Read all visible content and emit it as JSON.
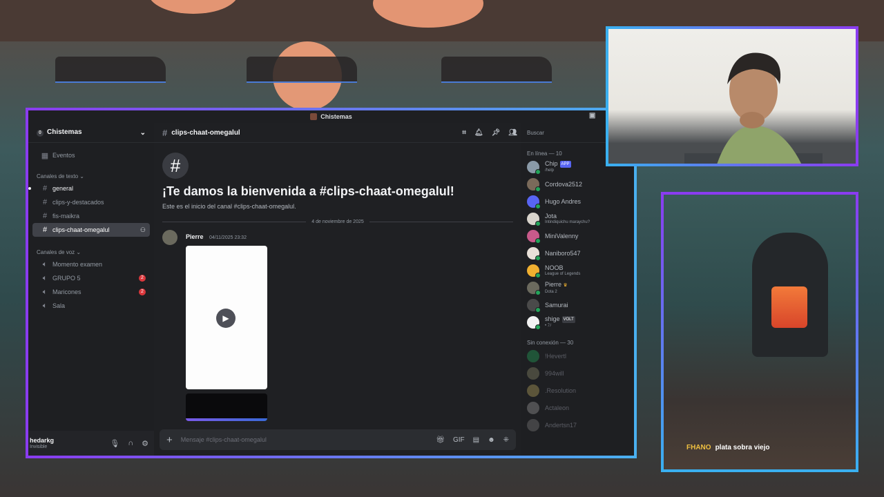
{
  "window": {
    "title": "Chistemas"
  },
  "server": {
    "name": "Chistemas",
    "icon_letter": "0",
    "events_label": "Eventos"
  },
  "sidebar": {
    "text_category": "Canales de texto",
    "text_channels": [
      {
        "name": "general",
        "unread": true
      },
      {
        "name": "clips-y-destacados"
      },
      {
        "name": "fis-maikra"
      },
      {
        "name": "clips-chaat-omegalul",
        "active": true
      }
    ],
    "voice_category": "Canales de voz",
    "voice_channels": [
      {
        "name": "Momento examen"
      },
      {
        "name": "GRUPO 5",
        "badge": "2"
      },
      {
        "name": "Maricones",
        "badge": "2"
      },
      {
        "name": "Sala"
      }
    ]
  },
  "user": {
    "name": "hedarkg",
    "status": "Invisible"
  },
  "channel": {
    "name": "clips-chaat-omegalul",
    "welcome_title": "¡Te damos la bienvenida a #clips-chaat-omegalul!",
    "welcome_sub": "Este es el inicio del canal #clips-chaat-omegalul.",
    "date_divider": "4 de noviembre de 2025",
    "message": {
      "author": "Pierre",
      "time": "04/11/2025 23:32"
    },
    "composer_placeholder": "Mensaje #clips-chaat-omegalul"
  },
  "members": {
    "search_placeholder": "Buscar",
    "online_header": "En línea — 10",
    "online": [
      {
        "name": "Chip",
        "tag": "APP",
        "activity": "/help"
      },
      {
        "name": "Cordova2512"
      },
      {
        "name": "Hugo Andres"
      },
      {
        "name": "Jota",
        "activity": "Intindiquichu maraychu?"
      },
      {
        "name": "MiniValenny"
      },
      {
        "name": "Naniboro547"
      },
      {
        "name": "NOOB",
        "activity": "League of Legends"
      },
      {
        "name": "Pierre",
        "activity": "Dota 2"
      },
      {
        "name": "Samurai"
      },
      {
        "name": "shige",
        "tag": "VOLT",
        "activity": "• ﾌﾉ"
      }
    ],
    "offline_header": "Sin conexión — 30",
    "offline": [
      {
        "name": "!Hevertl"
      },
      {
        "name": "994will"
      },
      {
        "name": ".Resolution"
      },
      {
        "name": "Actaleon"
      },
      {
        "name": "Andertsn17"
      }
    ]
  },
  "overlay_chat": {
    "user": "FHANO",
    "text": "plata sobra viejo"
  },
  "colors": {
    "accent": "#5865f2",
    "frame_start": "#8a3cf0",
    "frame_end": "#4ab0f0"
  }
}
